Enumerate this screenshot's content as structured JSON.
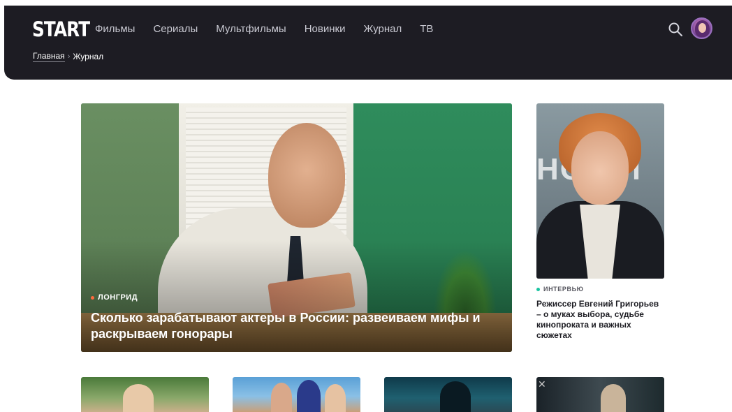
{
  "header": {
    "logo": "START",
    "nav": [
      "Фильмы",
      "Сериалы",
      "Мультфильмы",
      "Новинки",
      "Журнал",
      "ТВ"
    ],
    "breadcrumb": {
      "home": "Главная",
      "separator": "›",
      "current": "Журнал"
    },
    "icons": {
      "search": "search-icon",
      "avatar": "user-avatar"
    }
  },
  "hero": {
    "tag": "ЛОНГРИД",
    "tag_color": "#ff6a3d",
    "title": "Сколько зарабатывают актеры в России: развеиваем мифы и раскрываем гонорары"
  },
  "side_article": {
    "tag": "ИНТЕРВЬЮ",
    "tag_color": "#19c3a0",
    "image_text": "НО   АП",
    "title": "Режиссер Евгений Григорьев – о муках выбора, судьбе кинопроката и важных сюжетах"
  },
  "colors": {
    "header_bg": "#1d1c23",
    "page_bg": "#ffffff"
  }
}
